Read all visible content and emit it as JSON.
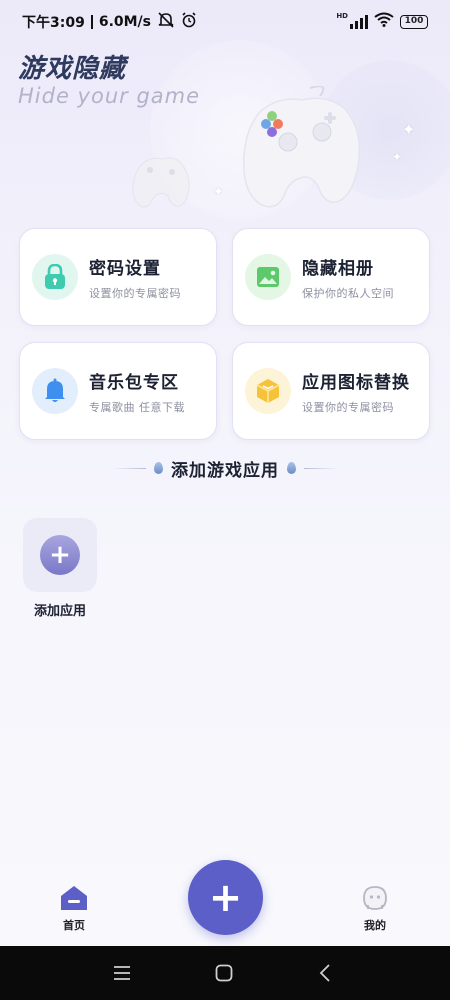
{
  "status_bar": {
    "time": "下午3:09",
    "speed": "6.0M/s",
    "hd_label": "HD",
    "battery": "100"
  },
  "header": {
    "title": "游戏隐藏",
    "subtitle": "Hide your game"
  },
  "cards": [
    {
      "title": "密码设置",
      "desc": "设置你的专属密码",
      "icon": "lock-icon",
      "color": "#3ecbb0",
      "bg": "#e2f6f0"
    },
    {
      "title": "隐藏相册",
      "desc": "保护你的私人空间",
      "icon": "image-icon",
      "color": "#5cc96a",
      "bg": "#e4f6e4"
    },
    {
      "title": "音乐包专区",
      "desc": "专属歌曲 任意下载",
      "icon": "bell-icon",
      "color": "#3f8ff0",
      "bg": "#e3eefc"
    },
    {
      "title": "应用图标替换",
      "desc": "设置你的专属密码",
      "icon": "cube-icon",
      "color": "#f5c23a",
      "bg": "#fdf3d6"
    }
  ],
  "section": {
    "title": "添加游戏应用"
  },
  "add_app": {
    "label": "添加应用"
  },
  "bottom_nav": {
    "home_label": "首页",
    "mine_label": "我的",
    "accent": "#5b5fc7"
  }
}
